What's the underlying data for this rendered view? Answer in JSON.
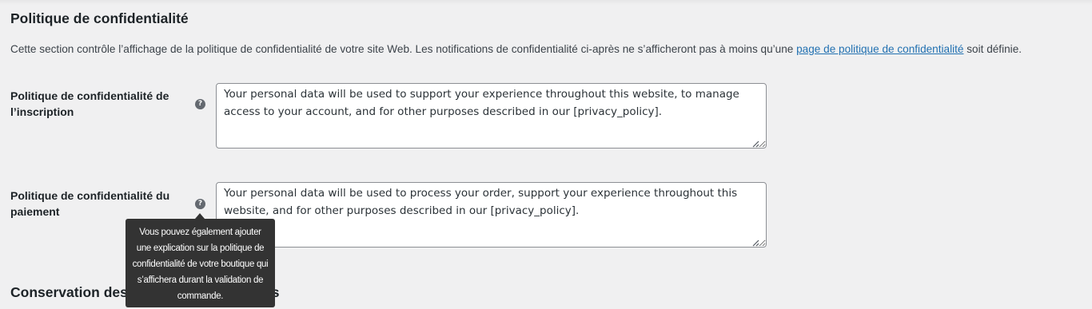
{
  "privacy_section": {
    "title": "Politique de confidentialité",
    "description_before_link": "Cette section contrôle l’affichage de la politique de confidentialité de votre site Web. Les notifications de confidentialité ci-après ne s’afficheront pas à moins qu’une ",
    "link_text": "page de politique de confidentialité",
    "description_after_link": " soit définie."
  },
  "fields": [
    {
      "label": "Politique de confidentialité de l’inscription",
      "value": "Your personal data will be used to support your experience throughout this website, to manage access to your account, and for other purposes described in our [privacy_policy]."
    },
    {
      "label": "Politique de confidentialité du paiement",
      "value": "Your personal data will be used to process your order, support your experience throughout this website, and for other purposes described in our [privacy_policy]."
    }
  ],
  "help_icon_glyph": "?",
  "tooltip": {
    "text": "Vous pouvez également ajouter une explication sur la politique de confidentialité de votre boutique qui s’affichera durant la validation de commande."
  },
  "next_section": {
    "title": "Conservation des données personnelles"
  },
  "colors": {
    "background": "#f0f0f1",
    "link": "#2271b1",
    "tooltip_bg": "#333333",
    "help_icon": "#646970"
  }
}
